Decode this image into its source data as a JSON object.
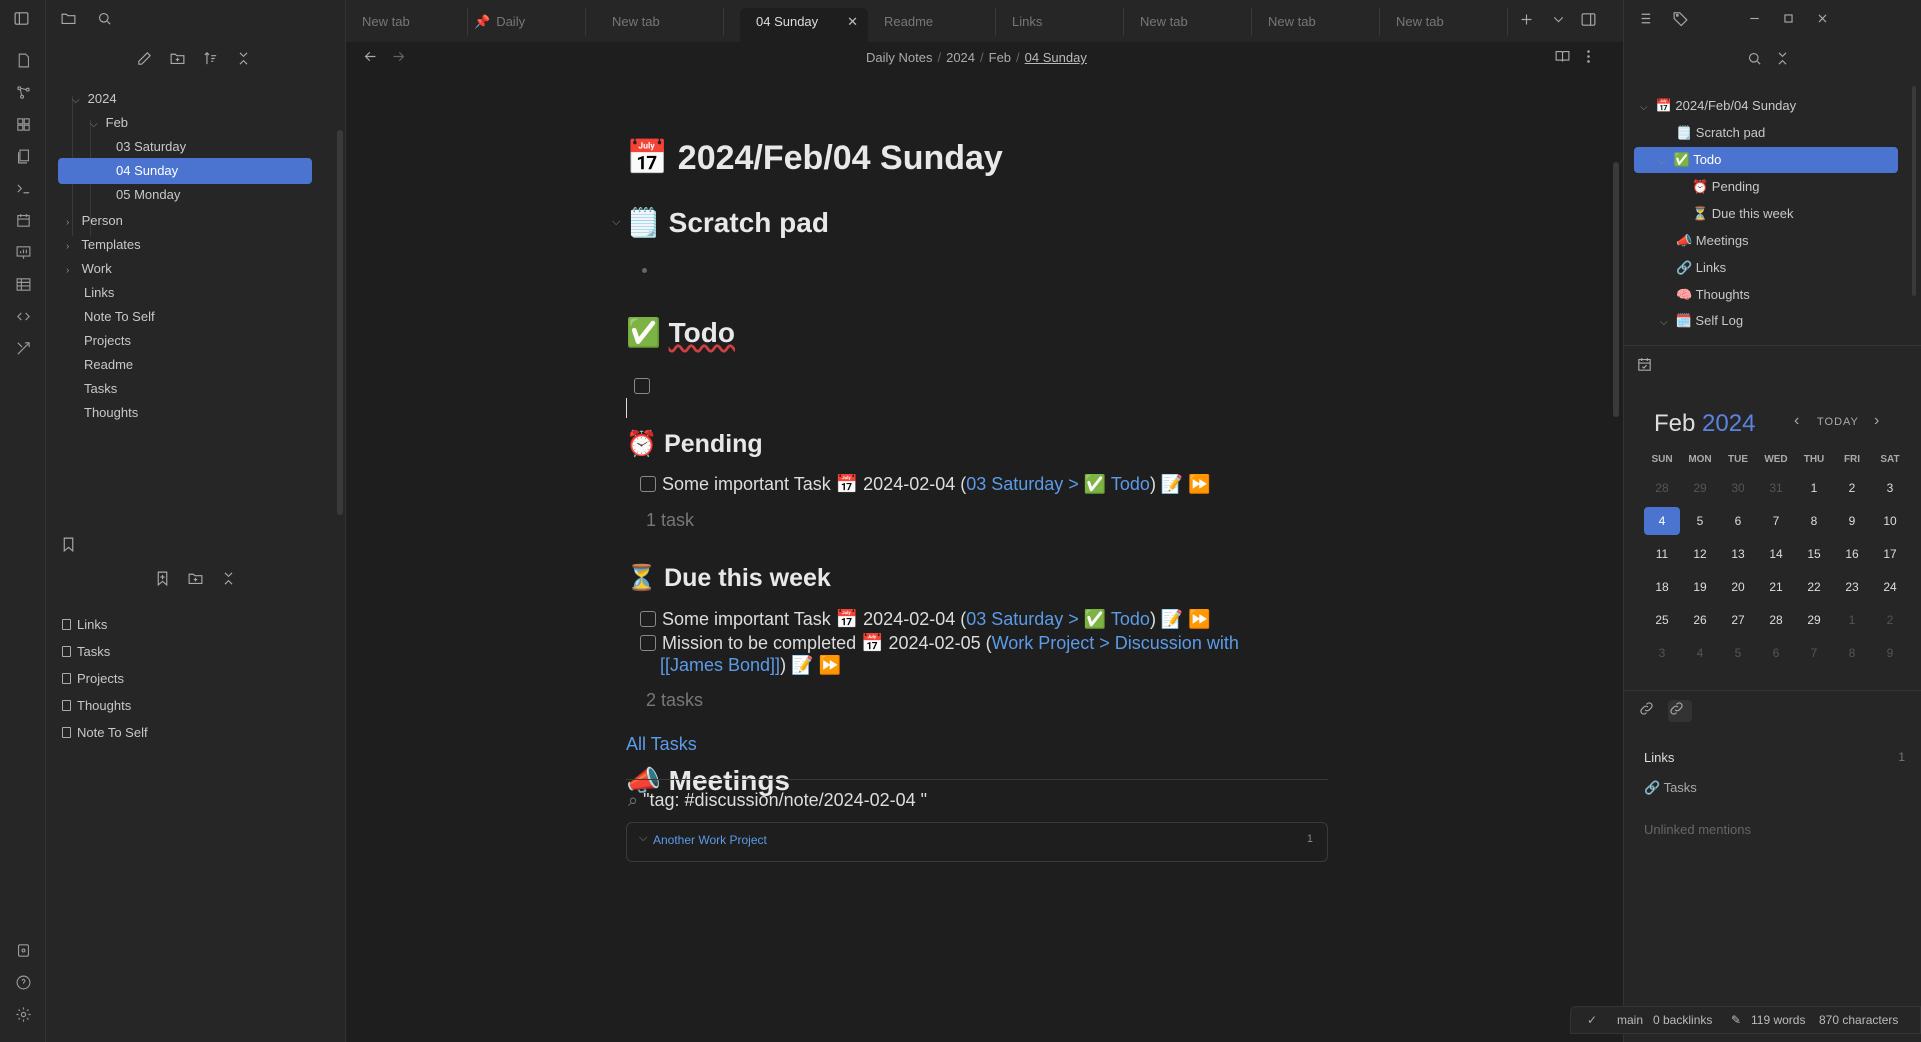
{
  "tabs": [
    {
      "label": "New tab"
    },
    {
      "label": "Daily"
    },
    {
      "label": "New tab"
    },
    {
      "label": "04 Sunday"
    },
    {
      "label": "Readme"
    },
    {
      "label": "Links"
    },
    {
      "label": "New tab"
    },
    {
      "label": "New tab"
    },
    {
      "label": "New tab"
    }
  ],
  "breadcrumb": [
    "Daily Notes",
    "2024",
    "Feb",
    "04 Sunday"
  ],
  "tree": {
    "year": "2024",
    "month": "Feb",
    "days": [
      "03 Saturday",
      "04 Sunday",
      "05 Monday"
    ],
    "folders": [
      "Person",
      "Templates",
      "Work"
    ],
    "files": [
      "Links",
      "Note To Self",
      "Projects",
      "Readme",
      "Tasks",
      "Thoughts"
    ]
  },
  "bookmarks": [
    "Links",
    "Tasks",
    "Projects",
    "Thoughts",
    "Note To Self"
  ],
  "note": {
    "title": "2024/Feb/04 Sunday",
    "title_emoji": "📅",
    "scratch": {
      "emoji": "🗒️",
      "label": "Scratch pad"
    },
    "todo": {
      "emoji": "✅",
      "label": "Todo"
    },
    "pending": {
      "emoji": "⏰",
      "label": "Pending",
      "task_text": "Some important Task 📅 2024-02-04 (",
      "task_link": "03 Saturday > ✅ Todo",
      "task_tail": ") 📝 ⏩",
      "count": "1 task"
    },
    "due": {
      "emoji": "⏳",
      "label": "Due this week",
      "task1_text": "Some important Task 📅 2024-02-04 (",
      "task1_link": "03 Saturday > ✅ Todo",
      "task1_tail": ") 📝 ⏩",
      "task2_text": "Mission to be completed 📅 2024-02-05 (",
      "task2_link": "Work Project > Discussion with",
      "task2_link2": "[[James Bond]]",
      "task2_tail": ") 📝 ⏩",
      "count": "2 tasks"
    },
    "all_tasks": "All Tasks",
    "meetings": {
      "emoji": "📣",
      "label": "Meetings"
    },
    "query": "\"tag: #discussion/note/2024-02-04 \"",
    "result_title": "Another Work Project",
    "result_count": "1"
  },
  "outline": [
    {
      "label": "📅 2024/Feb/04 Sunday"
    },
    {
      "label": "🗒️ Scratch pad"
    },
    {
      "label": "✅ Todo"
    },
    {
      "label": "⏰ Pending"
    },
    {
      "label": "⏳ Due this week"
    },
    {
      "label": "📣 Meetings"
    },
    {
      "label": "🔗 Links"
    },
    {
      "label": "🧠 Thoughts"
    },
    {
      "label": "🗓️ Self Log"
    }
  ],
  "calendar": {
    "month": "Feb",
    "year": "2024",
    "today_label": "TODAY",
    "dow": [
      "SUN",
      "MON",
      "TUE",
      "WED",
      "THU",
      "FRI",
      "SAT"
    ],
    "weeks": [
      [
        "28",
        "29",
        "30",
        "31",
        "1",
        "2",
        "3"
      ],
      [
        "4",
        "5",
        "6",
        "7",
        "8",
        "9",
        "10"
      ],
      [
        "11",
        "12",
        "13",
        "14",
        "15",
        "16",
        "17"
      ],
      [
        "18",
        "19",
        "20",
        "21",
        "22",
        "23",
        "24"
      ],
      [
        "25",
        "26",
        "27",
        "28",
        "29",
        "1",
        "2"
      ],
      [
        "3",
        "4",
        "5",
        "6",
        "7",
        "8",
        "9"
      ]
    ]
  },
  "backlinks": {
    "links_label": "Links",
    "links_count": "1",
    "item": "Tasks",
    "unlinked": "Unlinked mentions"
  },
  "status": {
    "branch": "main",
    "backlinks": "0 backlinks",
    "words": "119 words",
    "chars": "870 characters"
  },
  "colors": {
    "accent": "#4a74d0",
    "link": "#5b9be8",
    "bg": "#1e1e1e",
    "panel": "#262626"
  }
}
